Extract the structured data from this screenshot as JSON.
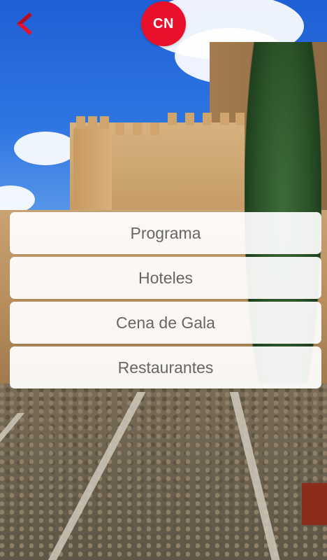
{
  "header": {
    "back_icon": "chevron-left-icon",
    "logo_text": "CN",
    "accent_color": "#e8102a"
  },
  "menu": {
    "items": [
      {
        "label": "Programa"
      },
      {
        "label": "Hoteles"
      },
      {
        "label": "Cena de Gala"
      },
      {
        "label": "Restaurantes"
      }
    ]
  }
}
